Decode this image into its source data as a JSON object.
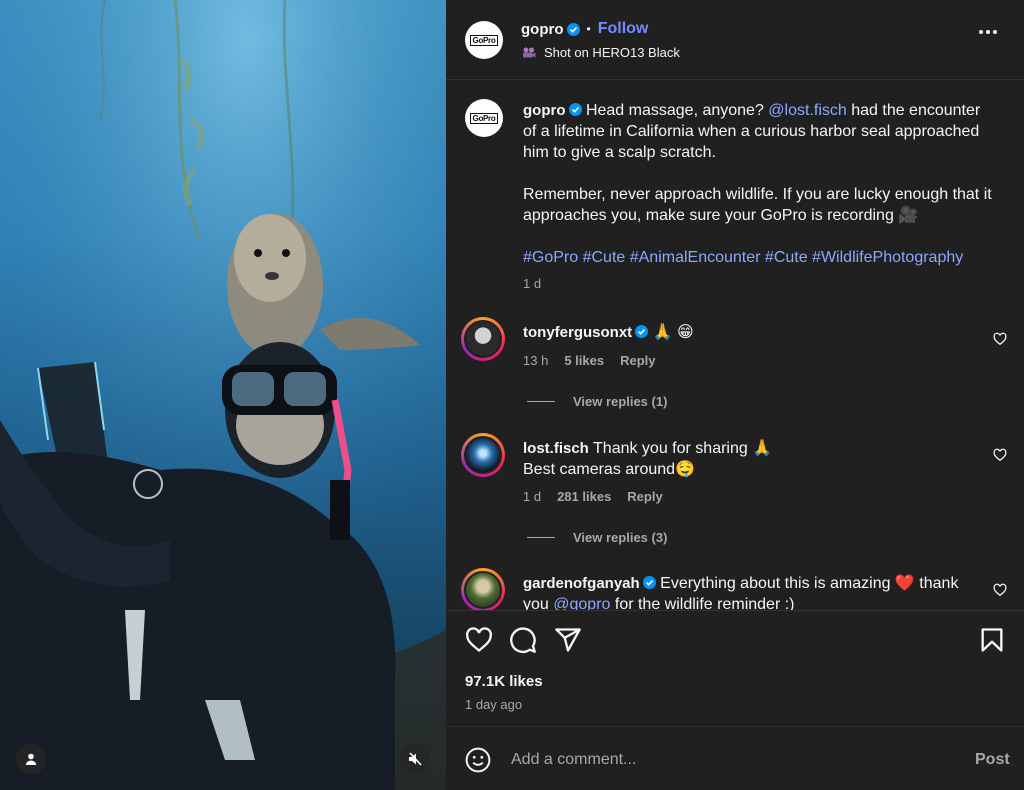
{
  "post": {
    "username": "gopro",
    "follow_label": "Follow",
    "avatar_logo_text": "GoPro",
    "subtitle": "Shot on HERO13 Black",
    "more_icon": "more-dots-icon",
    "caption": {
      "username": "gopro",
      "line1_pre": "Head massage, anyone? ",
      "mention": "@lost.fisch",
      "line1_post": " had the encounter of a lifetime in California when a curious harbor seal approached him to give a scalp scratch.",
      "paragraph2": "Remember, never approach wildlife. If you are lucky enough that it approaches you, make sure your GoPro is recording 🎥",
      "hashtags": "#GoPro #Cute #AnimalEncounter #Cute #WildlifePhotography",
      "time": "1 d"
    }
  },
  "comments": [
    {
      "username": "tonyfergusonxt",
      "text": "🙏 😁",
      "time": "13 h",
      "likes": "5 likes",
      "reply_label": "Reply",
      "view_replies": "View replies (1)"
    },
    {
      "username": "lost.fisch",
      "text": "Thank you for sharing 🙏",
      "text2": "Best cameras around🤤",
      "time": "1 d",
      "likes": "281 likes",
      "reply_label": "Reply",
      "view_replies": "View replies (3)"
    },
    {
      "username": "gardenofganyah",
      "text_pre": "Everything about this is amazing ❤️ thank you ",
      "mention": "@gopro",
      "text_post": " for the wildlife reminder :)"
    }
  ],
  "actions": {
    "like_icon": "heart-icon",
    "comment_icon": "comment-icon",
    "share_icon": "share-icon",
    "save_icon": "bookmark-icon",
    "likes": "97.1K likes",
    "time_ago": "1 day ago"
  },
  "add_comment": {
    "placeholder": "Add a comment...",
    "post_label": "Post"
  },
  "colors": {
    "panel_bg": "#202020",
    "link": "#8ea6ff",
    "follow": "#708dff",
    "verified": "#0095f6"
  }
}
